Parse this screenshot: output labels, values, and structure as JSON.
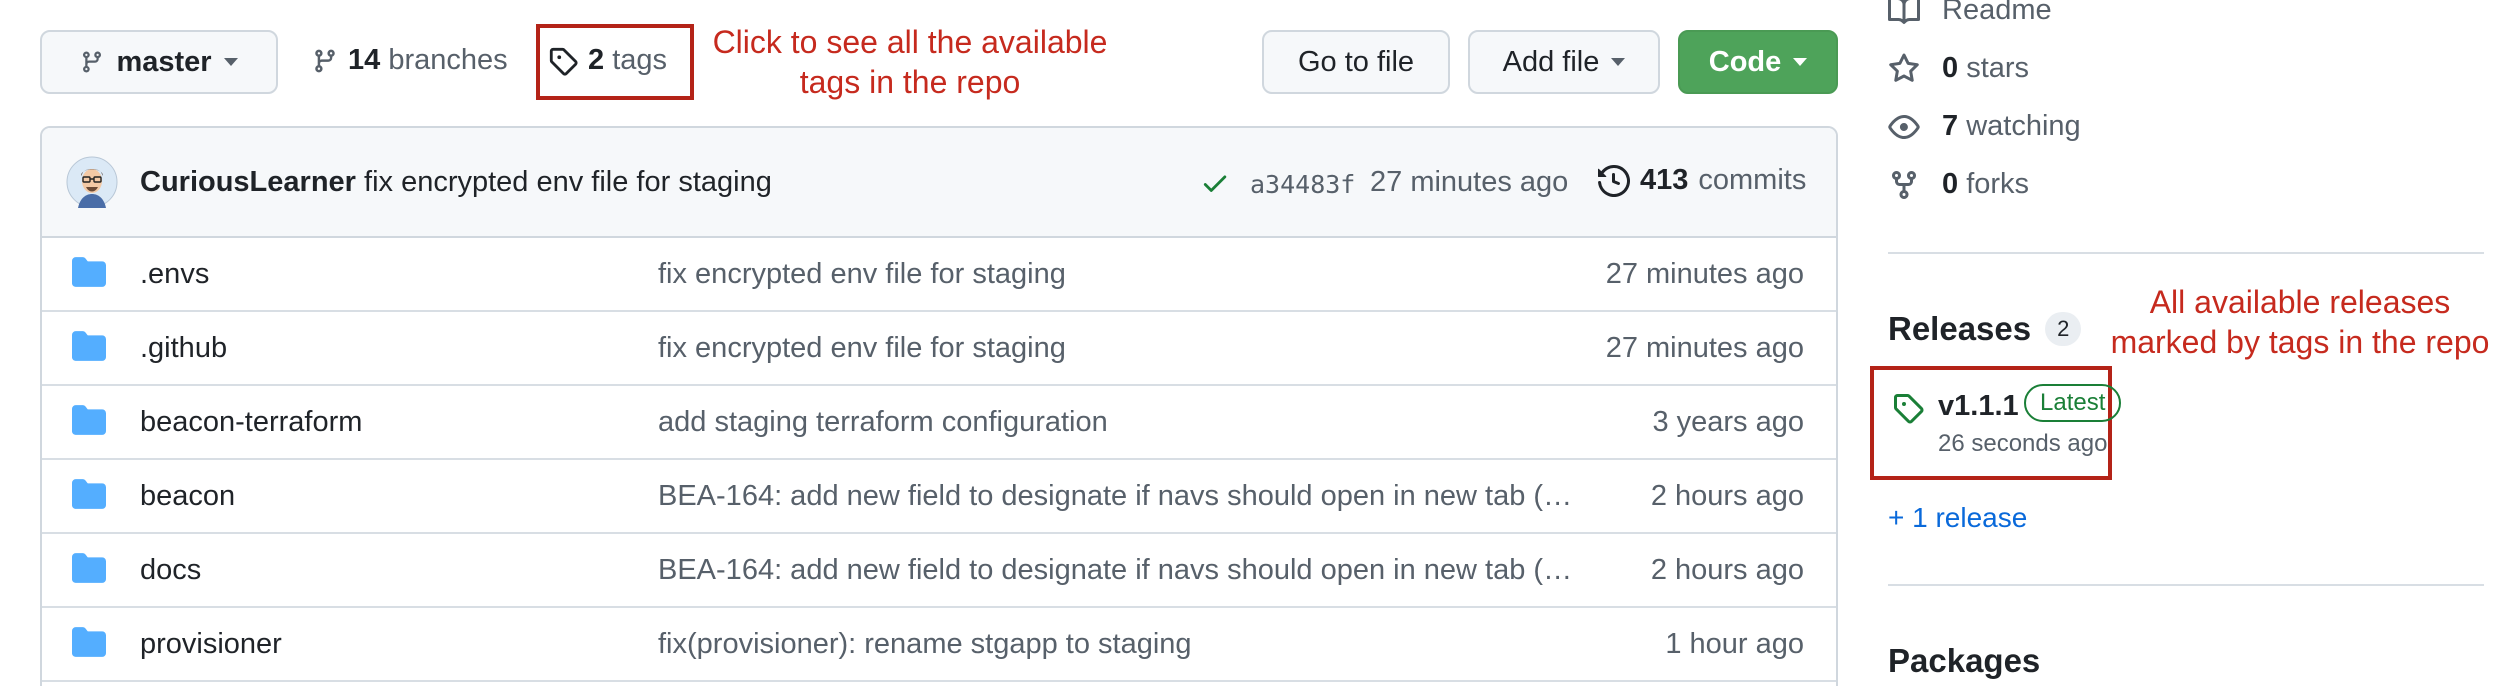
{
  "toolbar": {
    "branch": "master",
    "branches_count": "14",
    "branches_label": "branches",
    "tags_count": "2",
    "tags_label": "tags",
    "go_to_file": "Go to file",
    "add_file": "Add file",
    "code": "Code"
  },
  "annotations": {
    "tags_note_line1": "Click to see all the available",
    "tags_note_line2": "tags in the repo",
    "releases_note_line1": "All available releases",
    "releases_note_line2": "marked by tags in the repo"
  },
  "commit": {
    "author": "CuriousLearner",
    "message": "fix encrypted env file for staging",
    "sha": "a34483f",
    "time": "27 minutes ago",
    "commits_count": "413",
    "commits_label": "commits"
  },
  "files": [
    {
      "name": ".envs",
      "message": "fix encrypted env file for staging",
      "time": "27 minutes ago"
    },
    {
      "name": ".github",
      "message": "fix encrypted env file for staging",
      "time": "27 minutes ago"
    },
    {
      "name": "beacon-terraform",
      "message": "add staging terraform configuration",
      "time": "3 years ago"
    },
    {
      "name": "beacon",
      "message": "BEA-164: add new field to designate if navs should open in new tab (…",
      "time": "2 hours ago"
    },
    {
      "name": "docs",
      "message": "BEA-164: add new field to designate if navs should open in new tab (…",
      "time": "2 hours ago"
    },
    {
      "name": "provisioner",
      "message": "fix(provisioner): rename stgapp to staging",
      "time": "1 hour ago"
    }
  ],
  "sidebar": {
    "readme": "Readme",
    "stars_count": "0",
    "stars_label": "stars",
    "watching_count": "7",
    "watching_label": "watching",
    "forks_count": "0",
    "forks_label": "forks",
    "releases_title": "Releases",
    "releases_count": "2",
    "release_tag": "v1.1.1",
    "release_badge": "Latest",
    "release_time": "26 seconds ago",
    "more_releases": "+ 1 release",
    "packages_title": "Packages"
  },
  "colors": {
    "accent_green": "#4ea35a",
    "annotation_red": "#c62a1e",
    "link_blue": "#0969da",
    "folder_blue": "#54aeff"
  }
}
